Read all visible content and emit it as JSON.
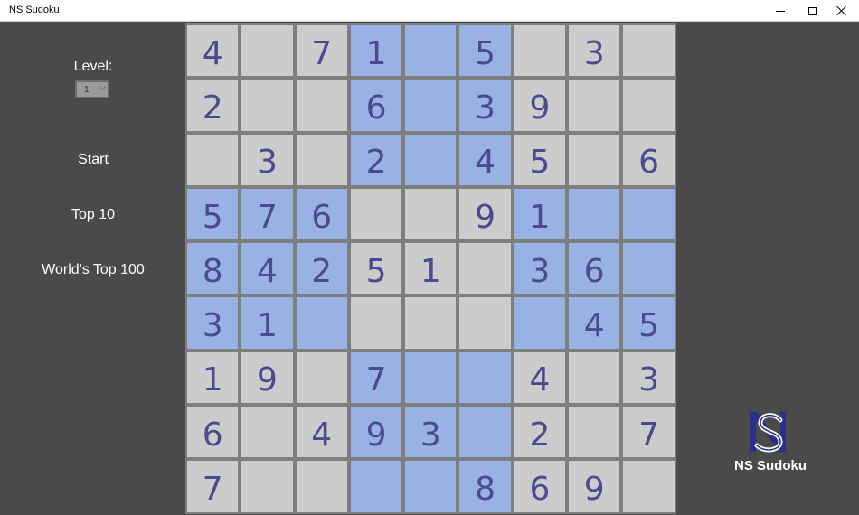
{
  "window": {
    "title": "NS Sudoku"
  },
  "sidebar": {
    "level_label": "Level:",
    "level_value": "1",
    "start_label": "Start",
    "top10_label": "Top 10",
    "top100_label": "World's Top 100"
  },
  "board": {
    "cells": [
      [
        "4",
        "",
        "7",
        "1",
        "",
        "5",
        "",
        "3",
        ""
      ],
      [
        "2",
        "",
        "",
        "6",
        "",
        "3",
        "9",
        "",
        ""
      ],
      [
        "",
        "3",
        "",
        "2",
        "",
        "4",
        "5",
        "",
        "6"
      ],
      [
        "5",
        "7",
        "6",
        "",
        "",
        "9",
        "1",
        "",
        ""
      ],
      [
        "8",
        "4",
        "2",
        "5",
        "1",
        "",
        "3",
        "6",
        ""
      ],
      [
        "3",
        "1",
        "",
        "",
        "",
        "",
        "",
        "4",
        "5"
      ],
      [
        "1",
        "9",
        "",
        "7",
        "",
        "",
        "4",
        "",
        "3"
      ],
      [
        "6",
        "",
        "4",
        "9",
        "3",
        "",
        "2",
        "",
        "7"
      ],
      [
        "7",
        "",
        "",
        "",
        "",
        "8",
        "6",
        "9",
        ""
      ]
    ],
    "highlighted": [
      [
        0,
        3
      ],
      [
        0,
        4
      ],
      [
        0,
        5
      ],
      [
        1,
        3
      ],
      [
        1,
        4
      ],
      [
        1,
        5
      ],
      [
        2,
        3
      ],
      [
        2,
        4
      ],
      [
        2,
        5
      ],
      [
        3,
        0
      ],
      [
        3,
        1
      ],
      [
        3,
        2
      ],
      [
        3,
        6
      ],
      [
        3,
        7
      ],
      [
        3,
        8
      ],
      [
        4,
        0
      ],
      [
        4,
        1
      ],
      [
        4,
        2
      ],
      [
        4,
        6
      ],
      [
        4,
        7
      ],
      [
        4,
        8
      ],
      [
        5,
        0
      ],
      [
        5,
        1
      ],
      [
        5,
        2
      ],
      [
        5,
        6
      ],
      [
        5,
        7
      ],
      [
        5,
        8
      ],
      [
        6,
        3
      ],
      [
        6,
        4
      ],
      [
        6,
        5
      ],
      [
        7,
        3
      ],
      [
        7,
        4
      ],
      [
        7,
        5
      ],
      [
        8,
        3
      ],
      [
        8,
        4
      ],
      [
        8,
        5
      ]
    ],
    "digit_color": "#4b4a8e",
    "cell_color": "#cccccc",
    "highlight_color": "#98b2e4"
  },
  "logo": {
    "text": "NS Sudoku"
  }
}
